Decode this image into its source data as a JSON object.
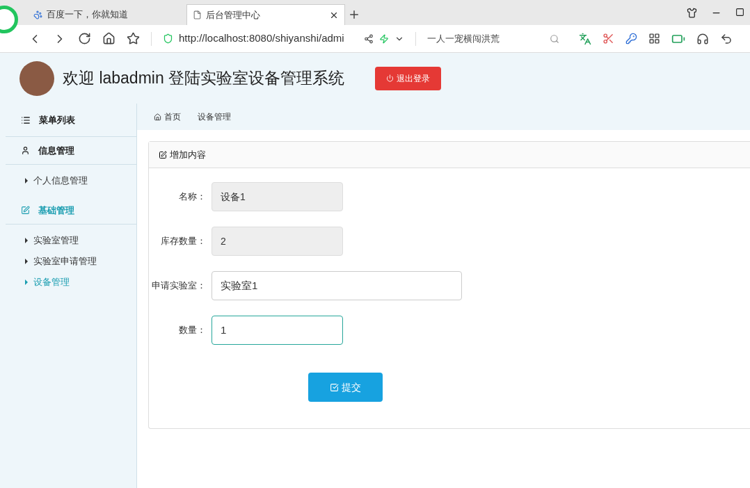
{
  "browser": {
    "tabs": [
      {
        "label": "百度一下，你就知道",
        "selected": false
      },
      {
        "label": "后台管理中心",
        "selected": true
      }
    ],
    "url": "http://localhost:8080/shiyanshi/admi",
    "search": "一人一宠横闯洪荒"
  },
  "header": {
    "title": "欢迎 labadmin 登陆实验室设备管理系统",
    "logout": "退出登录"
  },
  "sidebar": {
    "title": "菜单列表",
    "groups": [
      {
        "label": "信息管理",
        "expanded": true,
        "items": [
          {
            "label": "个人信息管理",
            "selected": false
          }
        ]
      },
      {
        "label": "基础管理",
        "expanded": true,
        "items": [
          {
            "label": "实验室管理",
            "selected": false
          },
          {
            "label": "实验室申请管理",
            "selected": false
          },
          {
            "label": "设备管理",
            "selected": true
          }
        ]
      }
    ]
  },
  "breadcrumb": [
    "首页",
    "设备管理"
  ],
  "form": {
    "title": "增加内容",
    "fields": [
      {
        "label": "名称：",
        "value": "设备1",
        "disabled": true,
        "focused": false
      },
      {
        "label": "库存数量：",
        "value": "2",
        "disabled": true,
        "focused": false
      },
      {
        "label": "申请实验室：",
        "value": "实验室1",
        "disabled": false,
        "focused": false
      },
      {
        "label": "数量：",
        "value": "1",
        "disabled": false,
        "focused": true
      }
    ],
    "submit": "提交"
  }
}
